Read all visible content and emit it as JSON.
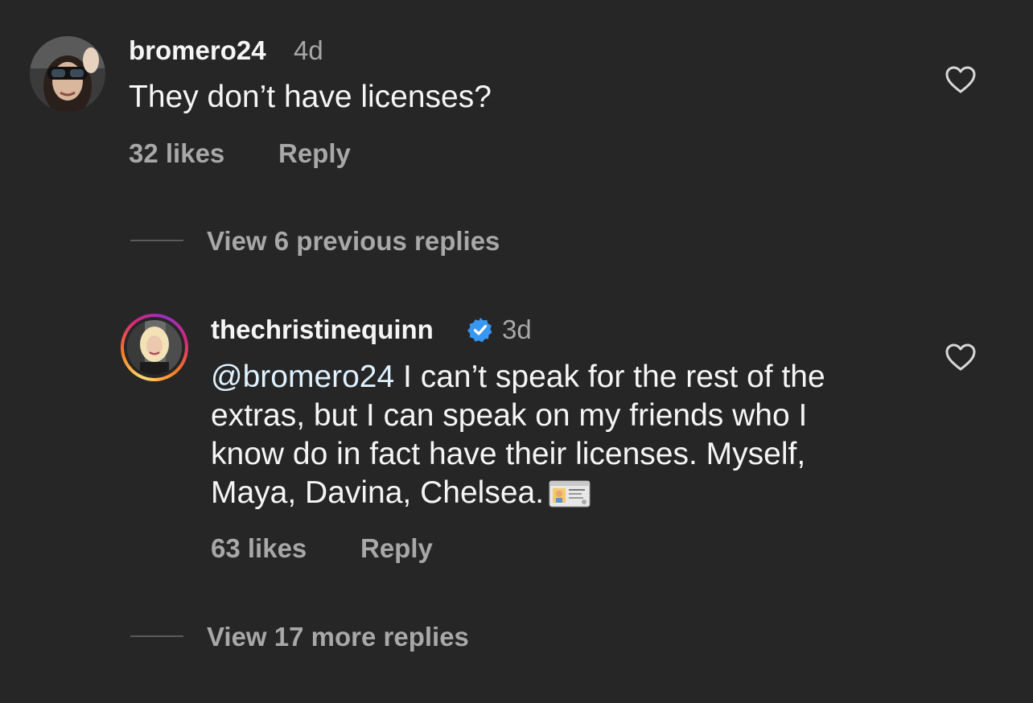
{
  "comments": [
    {
      "username": "bromero24",
      "time": "4d",
      "text": "They don’t have licenses?",
      "likes": "32 likes",
      "reply_label": "Reply"
    },
    {
      "username": "thechristinequinn",
      "verified": true,
      "time": "3d",
      "mention": "@bromero24",
      "text": " I can’t speak for the rest of the extras, but I can speak on my friends who I know do in fact have their licenses. Myself, Maya, Davina, Chelsea.",
      "emoji": "id-card",
      "likes": "63 likes",
      "reply_label": "Reply"
    }
  ],
  "view_previous_replies": "View 6 previous replies",
  "view_more_replies": "View 17 more replies",
  "colors": {
    "background": "#262626",
    "primary_text": "#f5f5f5",
    "secondary_text": "#a8a8a8",
    "mention": "#e0f1ff",
    "verified": "#3897f0"
  }
}
